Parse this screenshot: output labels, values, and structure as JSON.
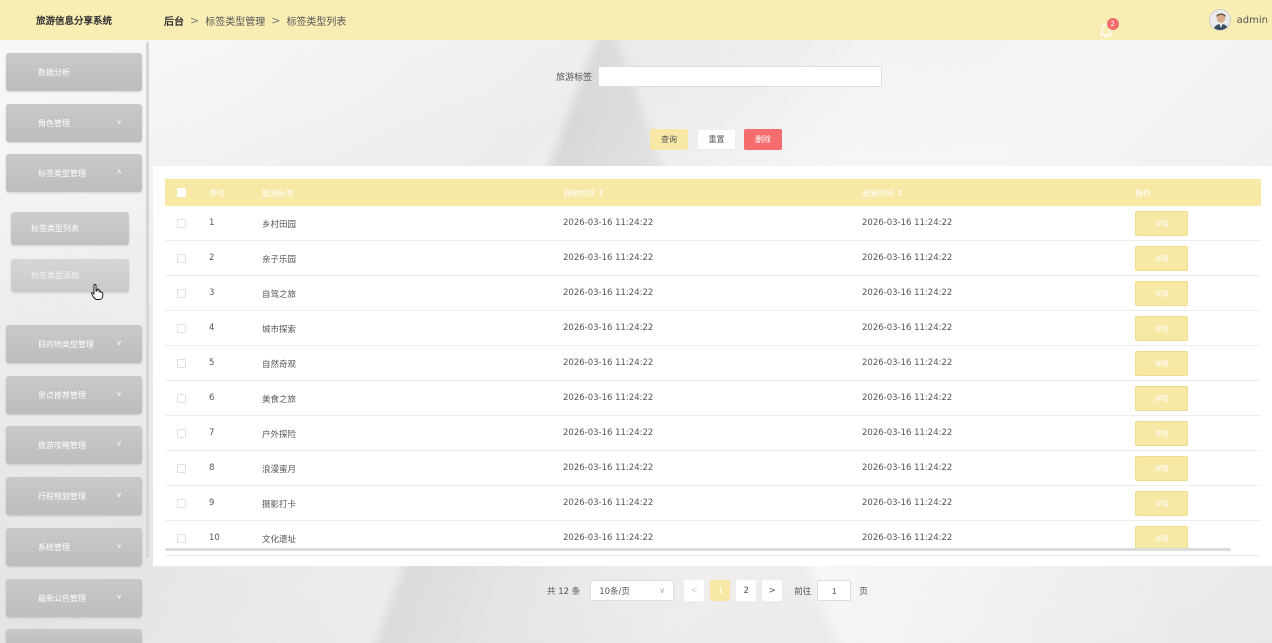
{
  "app": {
    "title": "旅游信息分享系统"
  },
  "breadcrumb": {
    "items": [
      "后台",
      "标签类型管理",
      "标签类型列表"
    ],
    "separator": ">"
  },
  "header": {
    "notification_count": "2",
    "username": "admin"
  },
  "sidebar": {
    "items": [
      {
        "label": "数据分析",
        "chevron": ""
      },
      {
        "label": "角色管理",
        "chevron": "∨"
      },
      {
        "label": "标签类型管理",
        "chevron": "∧"
      },
      {
        "label": "目的地类型管理",
        "chevron": "∨"
      },
      {
        "label": "景点推荐管理",
        "chevron": "∨"
      },
      {
        "label": "旅游攻略管理",
        "chevron": "∨"
      },
      {
        "label": "行程规划管理",
        "chevron": "∨"
      },
      {
        "label": "系统管理",
        "chevron": "∨"
      },
      {
        "label": "最新公告管理",
        "chevron": "∨"
      }
    ],
    "sub_items": [
      {
        "label": "标签类型列表"
      },
      {
        "label": "标签类型添加"
      }
    ]
  },
  "search": {
    "label": "旅游标签",
    "value": "",
    "placeholder": ""
  },
  "actions": {
    "query": "查询",
    "reset": "重置",
    "delete": "删除"
  },
  "table": {
    "headers": {
      "index": "序号",
      "tag": "旅游标签",
      "created": "创建时间 ⇕",
      "updated": "更新时间 ⇕",
      "ops": "操作"
    },
    "detail_label": "详情",
    "rows": [
      {
        "index": "1",
        "tag": "乡村田园",
        "created": "2026-03-16 11:24:22",
        "updated": "2026-03-16 11:24:22"
      },
      {
        "index": "2",
        "tag": "亲子乐园",
        "created": "2026-03-16 11:24:22",
        "updated": "2026-03-16 11:24:22"
      },
      {
        "index": "3",
        "tag": "自驾之旅",
        "created": "2026-03-16 11:24:22",
        "updated": "2026-03-16 11:24:22"
      },
      {
        "index": "4",
        "tag": "城市探索",
        "created": "2026-03-16 11:24:22",
        "updated": "2026-03-16 11:24:22"
      },
      {
        "index": "5",
        "tag": "自然奇观",
        "created": "2026-03-16 11:24:22",
        "updated": "2026-03-16 11:24:22"
      },
      {
        "index": "6",
        "tag": "美食之旅",
        "created": "2026-03-16 11:24:22",
        "updated": "2026-03-16 11:24:22"
      },
      {
        "index": "7",
        "tag": "户外探险",
        "created": "2026-03-16 11:24:22",
        "updated": "2026-03-16 11:24:22"
      },
      {
        "index": "8",
        "tag": "浪漫蜜月",
        "created": "2026-03-16 11:24:22",
        "updated": "2026-03-16 11:24:22"
      },
      {
        "index": "9",
        "tag": "摄影打卡",
        "created": "2026-03-16 11:24:22",
        "updated": "2026-03-16 11:24:22"
      },
      {
        "index": "10",
        "tag": "文化遗址",
        "created": "2026-03-16 11:24:22",
        "updated": "2026-03-16 11:24:22"
      }
    ]
  },
  "pagination": {
    "total": "共 12 条",
    "page_size": "10条/页",
    "prev": "<",
    "next": ">",
    "pages": [
      "1",
      "2"
    ],
    "current": "1",
    "goto_label": "前往",
    "goto_value": "1",
    "page_suffix": "页"
  },
  "colors": {
    "accent": "#f7e8a6",
    "topbar": "#f8eeb4",
    "danger": "#f56c6c",
    "sidebar": "#c4c4c4"
  }
}
